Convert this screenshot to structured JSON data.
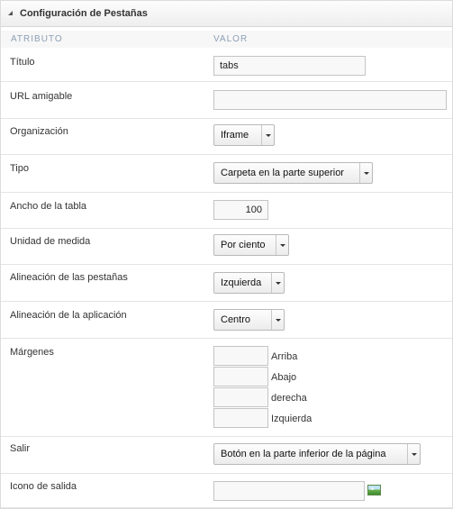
{
  "panel": {
    "title": "Configuración de Pestañas"
  },
  "columns": {
    "attribute": "ATRIBUTO",
    "value": "VALOR"
  },
  "fields": {
    "titulo": {
      "label": "Título",
      "value": "tabs"
    },
    "url": {
      "label": "URL amigable",
      "value": ""
    },
    "organizacion": {
      "label": "Organización",
      "selected": "Iframe"
    },
    "tipo": {
      "label": "Tipo",
      "selected": "Carpeta en la parte superior"
    },
    "ancho": {
      "label": "Ancho de la tabla",
      "value": "100"
    },
    "unidad": {
      "label": "Unidad de medida",
      "selected": "Por ciento"
    },
    "alineacion_pestanas": {
      "label": "Alineación de las pestañas",
      "selected": "Izquierda"
    },
    "alineacion_aplicacion": {
      "label": "Alineación de la aplicación",
      "selected": "Centro"
    },
    "margenes": {
      "label": "Márgenes",
      "items": [
        {
          "label": "Arriba",
          "value": ""
        },
        {
          "label": "Abajo",
          "value": ""
        },
        {
          "label": "derecha",
          "value": ""
        },
        {
          "label": "Izquierda",
          "value": ""
        }
      ]
    },
    "salir": {
      "label": "Salir",
      "selected": "Botón en la parte inferior de la página"
    },
    "icono_salida": {
      "label": "Icono de salida",
      "value": ""
    }
  },
  "icons": {
    "collapse": "collapse-triangle-icon",
    "image_picker": "image-picker-icon"
  }
}
